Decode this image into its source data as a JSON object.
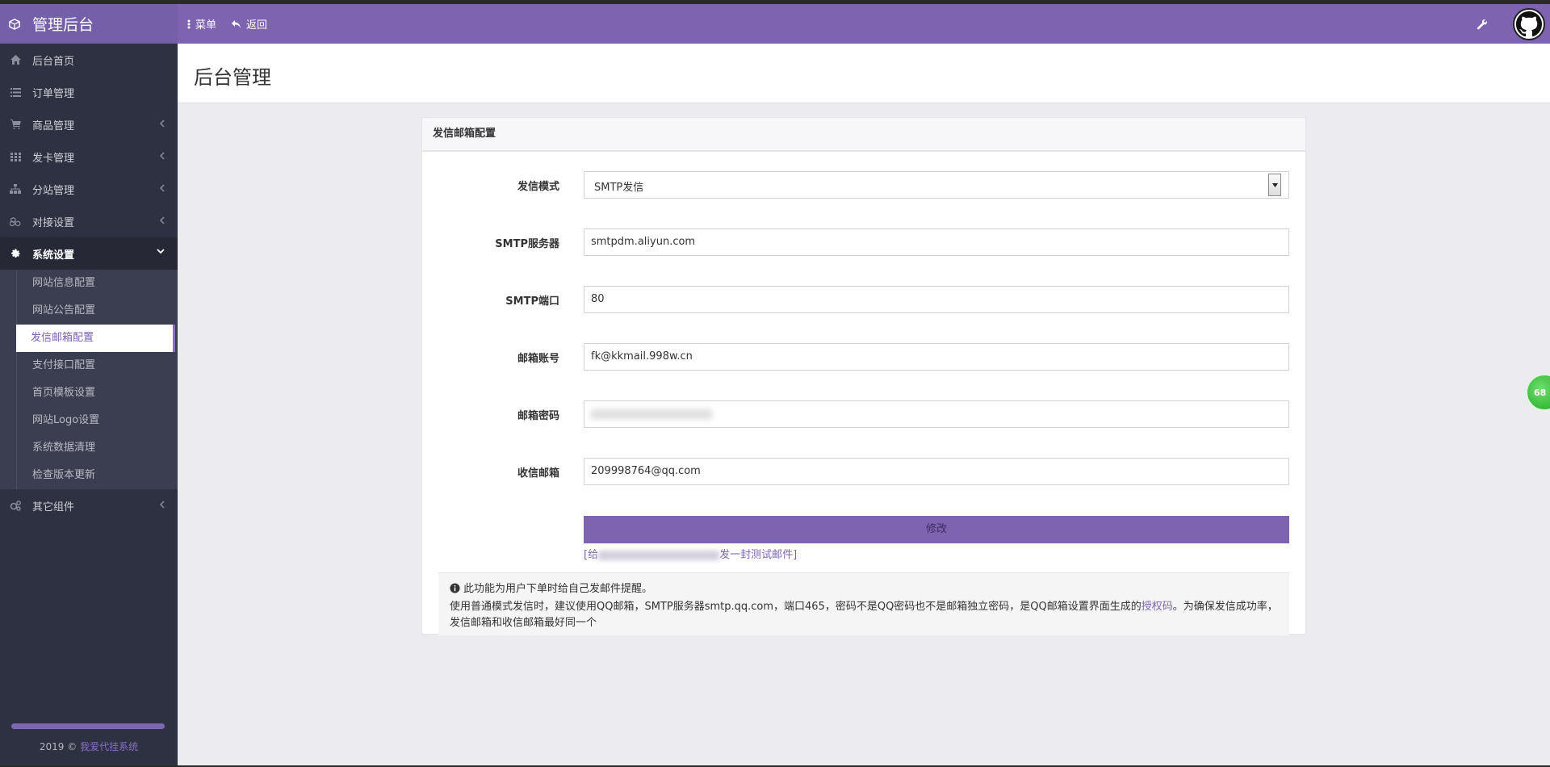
{
  "brand": {
    "title": "管理后台",
    "icon": "cube-icon"
  },
  "topnav": {
    "menu_label": "菜单",
    "back_label": "返回"
  },
  "sidebar": {
    "items": [
      {
        "label": "后台首页",
        "icon": "home-icon"
      },
      {
        "label": "订单管理",
        "icon": "list-icon"
      },
      {
        "label": "商品管理",
        "icon": "cart-icon"
      },
      {
        "label": "发卡管理",
        "icon": "grid-icon"
      },
      {
        "label": "分站管理",
        "icon": "sitemap-icon"
      },
      {
        "label": "对接设置",
        "icon": "cubes-icon"
      },
      {
        "label": "系统设置",
        "icon": "gear-icon"
      },
      {
        "label": "其它组件",
        "icon": "gears-icon"
      }
    ],
    "system_sub": [
      "网站信息配置",
      "网站公告配置",
      "发信邮箱配置",
      "支付接口配置",
      "首页模板设置",
      "网站Logo设置",
      "系统数据清理",
      "检查版本更新"
    ],
    "footer_year": "2019 ©",
    "footer_link": "我爱代挂系统"
  },
  "page": {
    "title": "后台管理"
  },
  "panel": {
    "heading": "发信邮箱配置",
    "fields": {
      "mode_label": "发信模式",
      "mode_value": "SMTP发信",
      "server_label": "SMTP服务器",
      "server_value": "smtpdm.aliyun.com",
      "port_label": "SMTP端口",
      "port_value": "80",
      "account_label": "邮箱账号",
      "account_value": "fk@kkmail.998w.cn",
      "password_label": "邮箱密码",
      "receiver_label": "收信邮箱",
      "receiver_value": "209998764@qq.com"
    },
    "submit_label": "修改",
    "test_prefix": "[给",
    "test_suffix": "发一封测试邮件]",
    "info_line1": "此功能为用户下单时给自己发邮件提醒。",
    "info_line2_a": "使用普通模式发信时，建议使用QQ邮箱，SMTP服务器smtp.qq.com，端口465，密码不是QQ密码也不是邮箱独立密码，是QQ邮箱设置界面生成的",
    "info_line2_link": "授权码",
    "info_line2_b": "。为确保发信成功率，发信邮箱和收信邮箱最好同一个"
  },
  "float_badge": "68"
}
